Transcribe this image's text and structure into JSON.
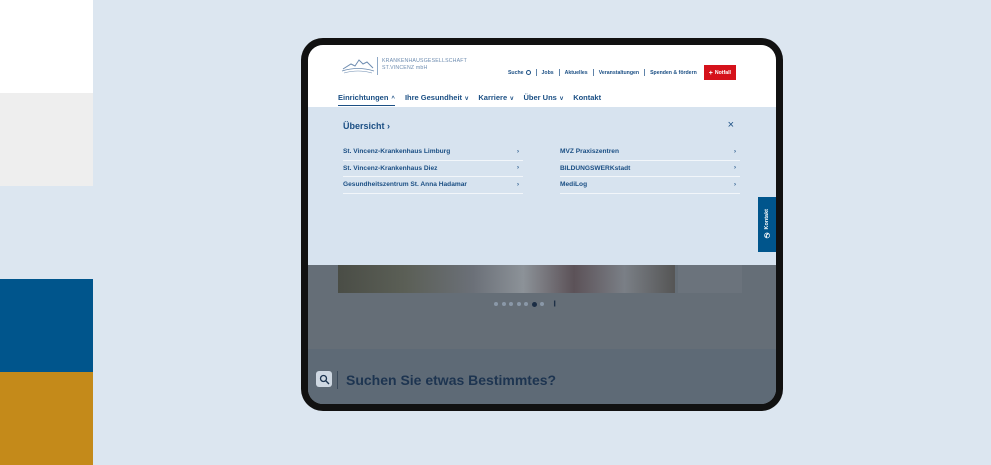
{
  "logo": {
    "line1": "KRANKENHAUSGESELLSCHAFT",
    "line2": "ST.VINCENZ mbH"
  },
  "topnav": {
    "suche": "Suche",
    "jobs": "Jobs",
    "aktuelles": "Aktuelles",
    "veranstaltungen": "Veranstaltungen",
    "spenden": "Spenden & fördern",
    "notfall": "Notfall"
  },
  "mainnav": {
    "items": [
      {
        "label": "Einrichtungen"
      },
      {
        "label": "Ihre Gesundheit"
      },
      {
        "label": "Karriere"
      },
      {
        "label": "Über Uns"
      },
      {
        "label": "Kontakt"
      }
    ]
  },
  "mega": {
    "title": "Übersicht",
    "left": [
      {
        "label": "St. Vincenz-Krankenhaus Limburg"
      },
      {
        "label": "St. Vincenz-Krankenhaus Diez"
      },
      {
        "label": "Gesundheitszentrum St. Anna Hadamar"
      }
    ],
    "right": [
      {
        "label": "MVZ Praxiszentren"
      },
      {
        "label": "BILDUNGSWERKstadt"
      },
      {
        "label": "MediLog"
      }
    ]
  },
  "side_tab": {
    "label": "Kontakt"
  },
  "slider": {
    "dot_count": 7,
    "active_dot": 6
  },
  "search": {
    "title": "Suchen Sie etwas Bestimmtes?"
  },
  "colors": {
    "primary": "#1b4f84",
    "accent_blue": "#00558c",
    "gold": "#c48a1a",
    "notfall_red": "#d5121b",
    "background": "#dce6f0"
  }
}
